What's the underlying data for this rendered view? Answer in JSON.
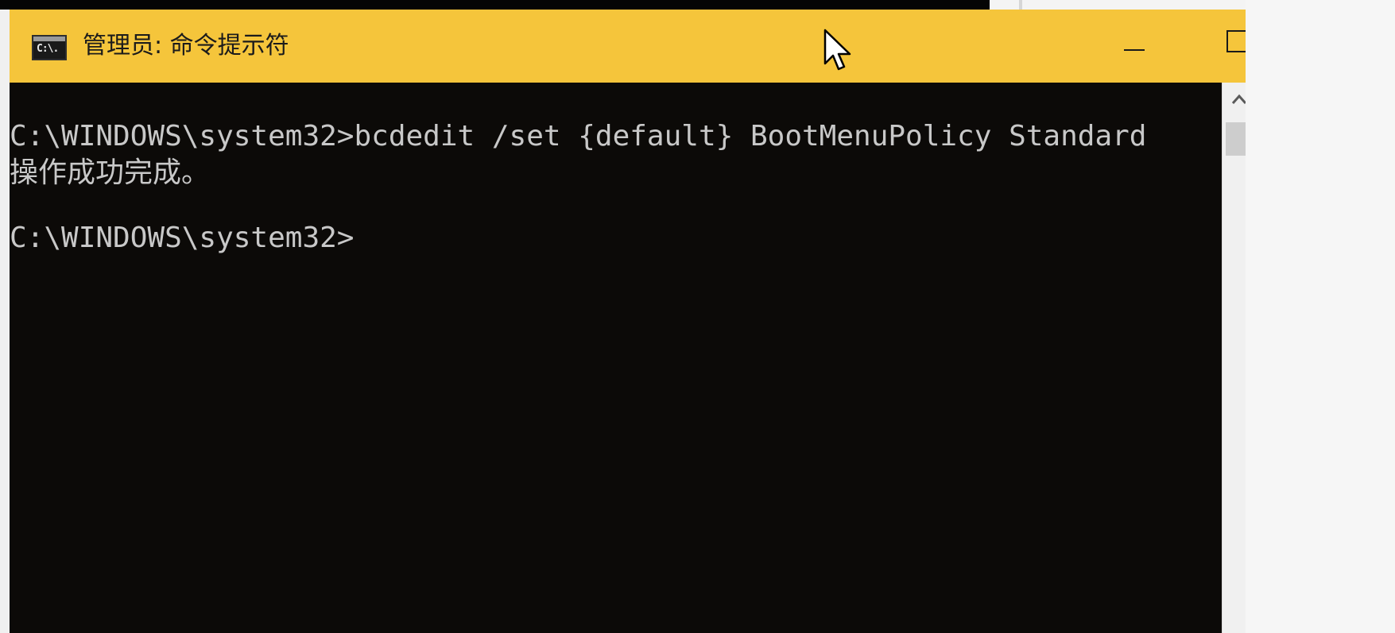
{
  "window": {
    "title": "管理员: 命令提示符",
    "icon": "cmd-icon",
    "icon_glyph": "C:\\.",
    "titlebar_color": "#f5c53b",
    "controls": {
      "minimize": "minimize-icon",
      "maximize": "maximize-icon",
      "close": "close-icon"
    }
  },
  "console": {
    "background": "#0c0a08",
    "text_color": "#c8c8c8",
    "lines": [
      "C:\\WINDOWS\\system32>bcdedit /set {default} BootMenuPolicy Standard",
      "操作成功完成。",
      "C:\\WINDOWS\\system32>"
    ]
  },
  "scrollbar": {
    "up_arrow": "chevron-up-icon"
  },
  "cursor": "mouse-pointer-icon"
}
